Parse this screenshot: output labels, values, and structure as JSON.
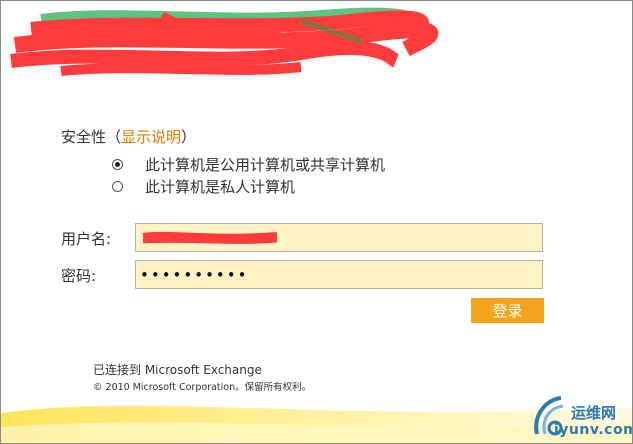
{
  "security": {
    "label": "安全性",
    "paren_open": "（",
    "show_explain_link": "显示说明",
    "paren_close": "）",
    "options": [
      {
        "label": "此计算机是公用计算机或共享计算机",
        "selected": true
      },
      {
        "label": "此计算机是私人计算机",
        "selected": false
      }
    ]
  },
  "form": {
    "username_label": "用户名:",
    "password_label": "密码:",
    "password_value": "••••••••••",
    "login_button": "登录"
  },
  "footer": {
    "connected": "已连接到  Microsoft Exchange",
    "copyright": "© 2010 Microsoft Corporation。保留所有权利。"
  },
  "watermark": {
    "site_cn": "运维网",
    "site_en": "iyunv.com"
  },
  "colors": {
    "link_orange": "#e07b00",
    "button_orange": "#f2a51c",
    "field_fill": "#fdf3c6",
    "redaction_red": "#ff3b3b",
    "watermark_blue": "#2a78b8"
  }
}
